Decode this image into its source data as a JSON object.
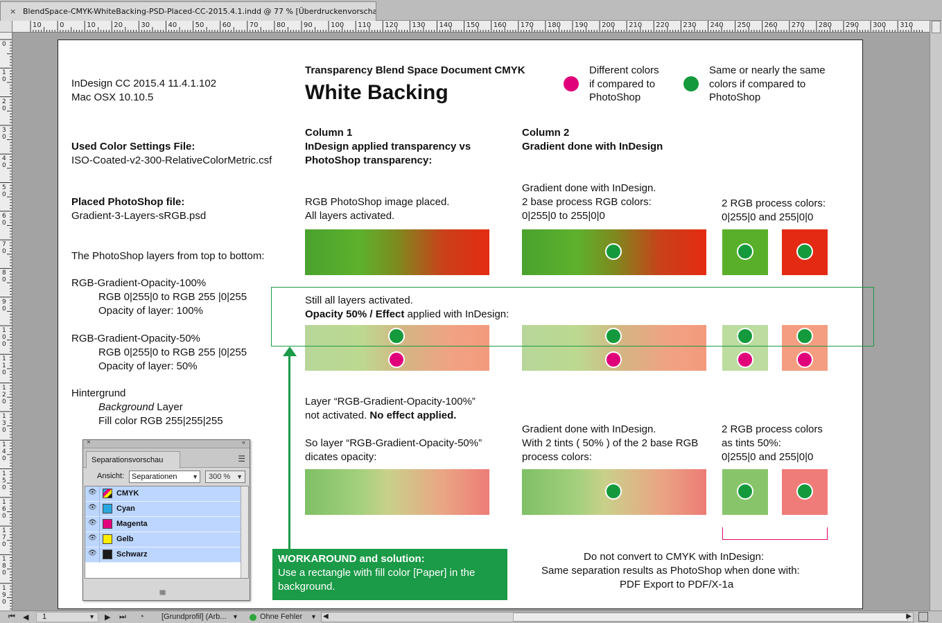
{
  "window": {
    "tab_title": "BlendSpace-CMYK-WhiteBacking-PSD-Placed-CC-2015.4.1.indd @ 77 % [Überdruckenvorschau]",
    "tab_close": "×"
  },
  "ruler": {
    "h_labels": [
      "10",
      "0",
      "10",
      "20",
      "30",
      "40",
      "50",
      "60",
      "70",
      "80",
      "90",
      "100",
      "110",
      "120",
      "130",
      "140",
      "150",
      "160",
      "170",
      "180",
      "190",
      "200",
      "210",
      "220",
      "230",
      "240",
      "250",
      "260",
      "270",
      "280",
      "290",
      "300",
      "310"
    ],
    "v_labels": [
      "0",
      "10",
      "20",
      "30",
      "40",
      "50",
      "60",
      "70",
      "80",
      "90",
      "100",
      "110",
      "120",
      "130",
      "140",
      "150",
      "160",
      "170",
      "180",
      "190",
      "200"
    ]
  },
  "page": {
    "version": "InDesign CC 2015.4 11.4.1.102",
    "os": "Mac OSX 10.10.5",
    "subtitle": "Transparency Blend Space Document CMYK",
    "title": "White Backing",
    "legend": {
      "diff_line1": "Different colors",
      "diff_line2": "if compared to",
      "diff_line3": "PhotoShop",
      "same_line1": "Same or nearly the same",
      "same_line2": "colors if compared to",
      "same_line3": "PhotoShop",
      "diff_color": "#e0007a",
      "same_color": "#149a3c"
    },
    "color_settings_label": "Used Color Settings File:",
    "color_settings_file": "ISO-Coated-v2-300-RelativeColorMetric.csf",
    "placed_label": "Placed PhotoShop file:",
    "placed_file": "Gradient-3-Layers-sRGB.psd",
    "layers_intro": "The PhotoShop layers from top to bottom:",
    "layer1_name": "RGB-Gradient-Opacity-100%",
    "layer1_rgb": "RGB 0|255|0 to RGB 255 |0|255",
    "layer1_opacity": "Opacity of layer: 100%",
    "layer2_name": "RGB-Gradient-Opacity-50%",
    "layer2_rgb": "RGB 0|255|0 to RGB 255 |0|255",
    "layer2_opacity": "Opacity of layer: 50%",
    "layer3_name": "Hintergrund",
    "layer3_bg_italic": "Background",
    "layer3_bg_rest": " Layer",
    "layer3_fill": "Fill color RGB 255|255|255",
    "col1_h1": "Column 1",
    "col1_h2": "InDesign applied transparency vs",
    "col1_h3": "PhotoShop transparency:",
    "col2_h1": "Column 2",
    "col2_h2": "Gradient done with InDesign",
    "row1_c1_l1": "RGB PhotoShop image placed.",
    "row1_c1_l2": "All layers activated.",
    "row1_c2_l1": "Gradient done with InDesign.",
    "row1_c2_l2": "2 base process RGB colors:",
    "row1_c2_l3": "0|255|0 to 255|0|0",
    "row1_c3_l1": "2 RGB process colors:",
    "row1_c3_l2": "0|255|0 and 255|0|0",
    "row2_l1": "Still all layers activated.",
    "row2_l2_bold": "Opacity 50% / Effect",
    "row2_l2_rest": " applied with InDesign:",
    "row3_l1": "Layer “RGB-Gradient-Opacity-100%”",
    "row3_l2_plain": "not activated. ",
    "row3_l2_bold": "No effect applied.",
    "row3_l3": "So layer “RGB-Gradient-Opacity-50%”",
    "row3_l4": "dicates opacity:",
    "row3_c2_l1": "Gradient done with InDesign.",
    "row3_c2_l2": "With 2 tints ( 50% ) of the 2 base RGB",
    "row3_c2_l3": "process colors:",
    "row3_c3_l1": "2 RGB process colors",
    "row3_c3_l2": "as tints 50%:",
    "row3_c3_l3": "0|255|0 and 255|0|0",
    "workaround_title": "WORKAROUND and solution:",
    "workaround_body1": "Use a rectangle with fill color [Paper] in the",
    "workaround_body2": "background.",
    "bottom_l1": "Do not convert to CMYK with InDesign:",
    "bottom_l2": "Same separation results as PhotoShop when done with:",
    "bottom_l3": "PDF Export to PDF/X-1a",
    "accent_green": "#1b9a47",
    "accent_magenta": "#e0006a"
  },
  "separations": {
    "tab_label": "Separationsvorschau",
    "view_label": "Ansicht:",
    "view_value": "Separationen",
    "zoom_value": "300 %",
    "rows": [
      {
        "name": "CMYK",
        "color": "cmyk"
      },
      {
        "name": "Cyan",
        "color": "#2aa7e0"
      },
      {
        "name": "Magenta",
        "color": "#e3007e"
      },
      {
        "name": "Gelb",
        "color": "#ffed00"
      },
      {
        "name": "Schwarz",
        "color": "#1a1a1a"
      }
    ]
  },
  "statusbar": {
    "page_number": "1",
    "profile": "[Grundprofil] (Arb...",
    "preflight": "Ohne Fehler"
  }
}
